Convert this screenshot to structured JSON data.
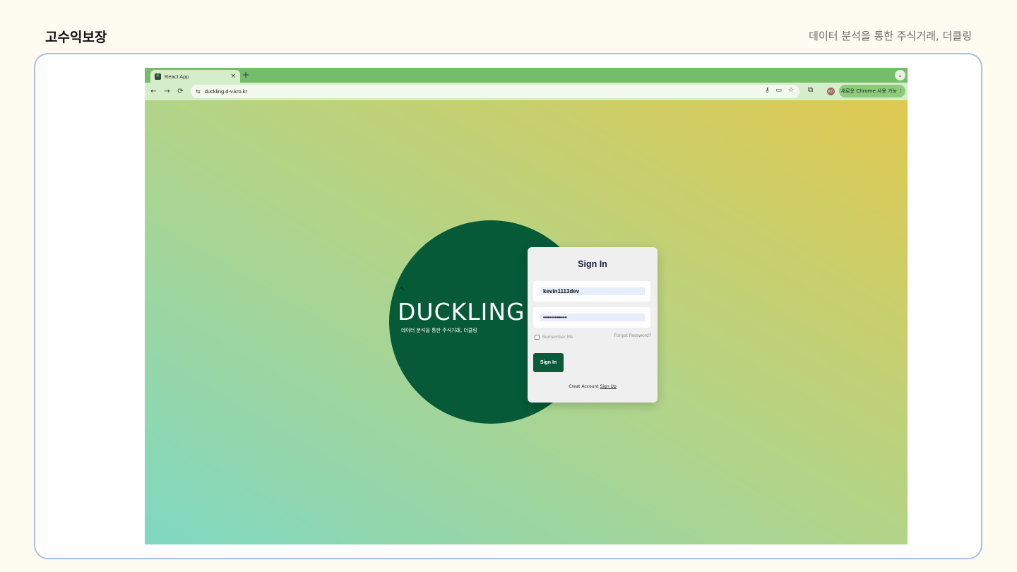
{
  "slide": {
    "title": "고수익보장",
    "subtitle": "데이터 분석을 통한 주식거래, 더클링"
  },
  "browser": {
    "tab_title": "React App",
    "tab_close": "×",
    "new_tab": "+",
    "tab_menu": "⌄",
    "back": "←",
    "forward": "→",
    "reload": "⟳",
    "site_settings": "⇆",
    "url": "duckling.d-v.kro.kr",
    "key_icon": "⚷",
    "cast_icon": "▭",
    "star_icon": "☆",
    "extension_icon": "⧉",
    "profile_initials": "KD",
    "chrome_pill": "새로운 Chrome 사용 가능 ⋮"
  },
  "hero": {
    "brand": "DUCKLING",
    "tagline": "데이터 분석을 통한 주식거래, 더클링"
  },
  "login": {
    "title": "Sign In",
    "username_value": "kevin1113dev",
    "password_value": "••••••••••••",
    "remember_label": "Remember Me",
    "forgot_label": "Forgot Password?",
    "signin_button": "Sign In",
    "create_text": "Creat Account",
    "signup_link": "Sign Up"
  },
  "colors": {
    "brand_green": "#065a38",
    "tab_bar": "#74bd6b",
    "frame_border": "#a9c1e2"
  }
}
